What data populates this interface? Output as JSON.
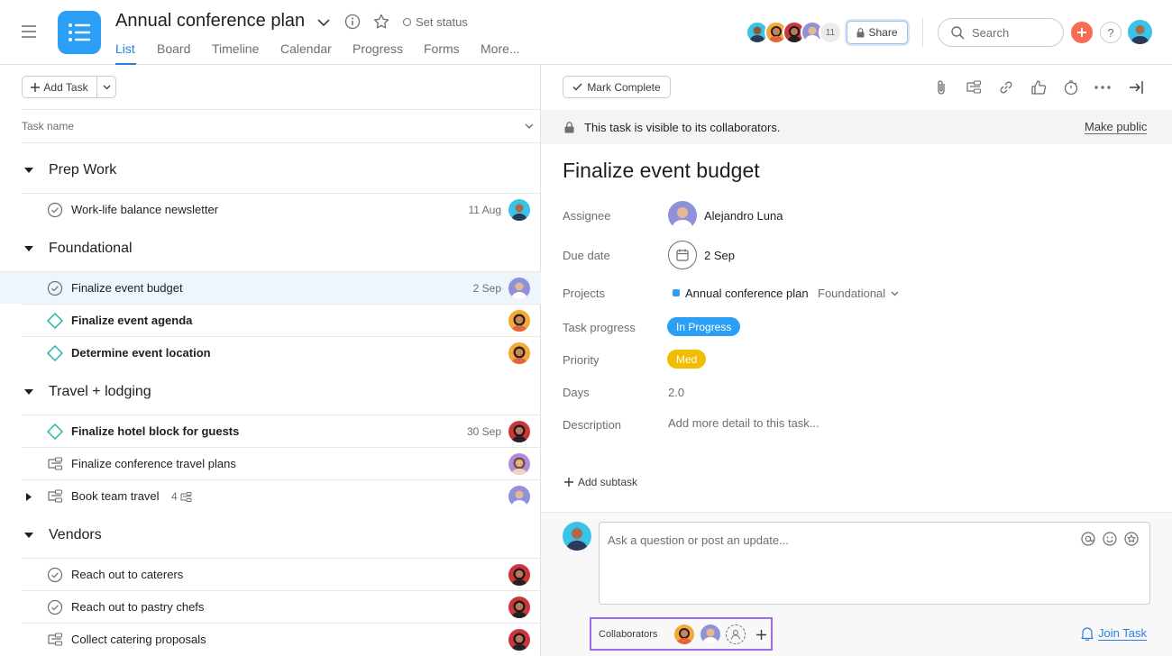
{
  "header": {
    "project_title": "Annual conference plan",
    "set_status": "Set status",
    "tabs": [
      "List",
      "Board",
      "Timeline",
      "Calendar",
      "Progress",
      "Forms",
      "More..."
    ],
    "member_count": "11",
    "share_label": "Share",
    "search_placeholder": "Search",
    "help_label": "?"
  },
  "list": {
    "add_task_label": "Add Task",
    "column_header": "Task name",
    "sections": [
      {
        "name": "Prep Work"
      },
      {
        "name": "Foundational"
      },
      {
        "name": "Travel + lodging"
      },
      {
        "name": "Vendors"
      }
    ],
    "tasks": [
      {
        "name": "Work-life balance newsletter",
        "date": "11 Aug",
        "icon": "check-circle-icon"
      },
      {
        "name": "Finalize event budget",
        "date": "2 Sep",
        "icon": "check-circle-icon"
      },
      {
        "name": "Finalize event agenda",
        "date": "",
        "icon": "milestone-diamond-icon"
      },
      {
        "name": "Determine event location",
        "date": "",
        "icon": "milestone-diamond-icon"
      },
      {
        "name": "Finalize hotel block for guests",
        "date": "30 Sep",
        "icon": "milestone-diamond-icon"
      },
      {
        "name": "Finalize conference travel plans",
        "date": "",
        "icon": "subtask-icon"
      },
      {
        "name": "Book team travel",
        "date": "",
        "icon": "subtask-icon",
        "subtask_count": "4"
      },
      {
        "name": "Reach out to caterers",
        "date": "",
        "icon": "check-circle-icon"
      },
      {
        "name": "Reach out to pastry chefs",
        "date": "",
        "icon": "check-circle-icon"
      },
      {
        "name": "Collect catering proposals",
        "date": "",
        "icon": "subtask-icon"
      }
    ]
  },
  "detail": {
    "mark_complete": "Mark Complete",
    "visibility_text": "This task is visible to its collaborators.",
    "make_public": "Make public",
    "title": "Finalize event budget",
    "fields": {
      "assignee_label": "Assignee",
      "assignee": "Alejandro Luna",
      "due_label": "Due date",
      "due": "2 Sep",
      "projects_label": "Projects",
      "project": "Annual conference plan",
      "section": "Foundational",
      "progress_label": "Task progress",
      "progress": "In Progress",
      "priority_label": "Priority",
      "priority": "Med",
      "days_label": "Days",
      "days": "2.0",
      "description_label": "Description",
      "description_placeholder": "Add more detail to this task..."
    },
    "add_subtask": "Add subtask",
    "comment_placeholder": "Ask a question or post an update...",
    "collaborators_label": "Collaborators",
    "join_task": "Join Task"
  },
  "colors": {
    "accent": "#2a7de1",
    "logo": "#2a9ff5",
    "progress_pill": "#2a9ff5",
    "priority_pill": "#f1bd00",
    "milestone": "#25b5a4",
    "collab_border": "#9b6ded"
  }
}
